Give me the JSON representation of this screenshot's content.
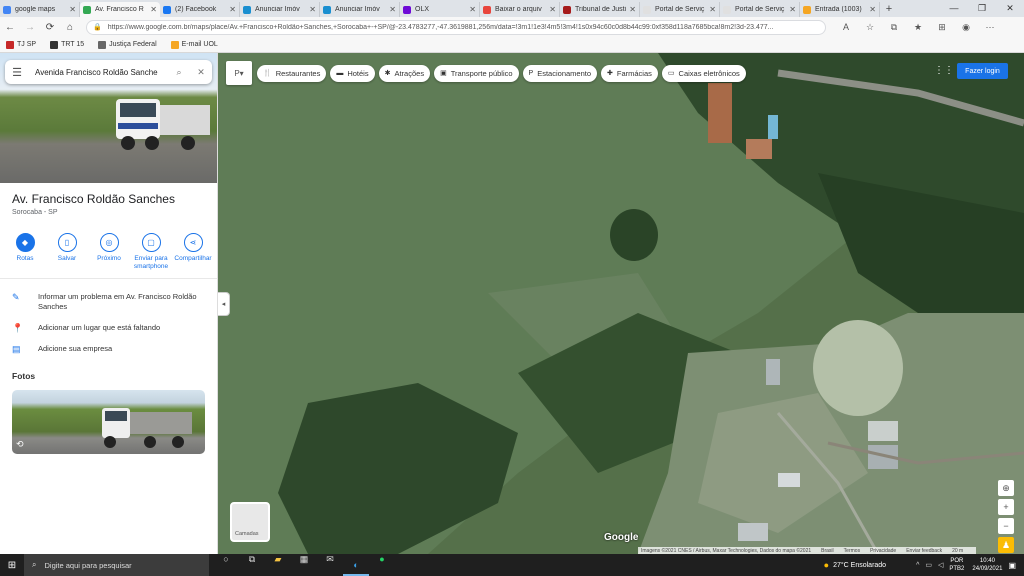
{
  "browser": {
    "tabs": [
      {
        "title": "google maps",
        "color": "#4285f4",
        "active": false
      },
      {
        "title": "Av. Francisco R",
        "color": "#34a853",
        "active": true
      },
      {
        "title": "(2) Facebook",
        "color": "#1877f2",
        "active": false
      },
      {
        "title": "Anunciar Imóv",
        "color": "#1a8fd0",
        "active": false
      },
      {
        "title": "Anunciar Imóv",
        "color": "#1a8fd0",
        "active": false
      },
      {
        "title": "OLX",
        "color": "#6e0ad6",
        "active": false
      },
      {
        "title": "Baixar o arquiv",
        "color": "#e8453c",
        "active": false
      },
      {
        "title": "Tribunal de Justi",
        "color": "#a61b1b",
        "active": false
      },
      {
        "title": "Portal de Serviç",
        "color": "#e0e0e0",
        "active": false
      },
      {
        "title": "Portal de Serviç",
        "color": "#e0e0e0",
        "active": false
      },
      {
        "title": "Entrada (1003)",
        "color": "#f5a623",
        "active": false
      }
    ],
    "new_tab": "+",
    "window_controls": [
      "—",
      "❐",
      "✕"
    ],
    "url": "https://www.google.com.br/maps/place/Av.+Francisco+Roldão+Sanches,+Sorocaba+-+SP/@-23.4783277,-47.3619881,256m/data=!3m1!1e3!4m5!3m4!1s0x94c60c0d8b44c99:0xf358d118a7685bca!8m2!3d-23.477...",
    "bookmarks": [
      {
        "label": "TJ SP",
        "color": "#c62828"
      },
      {
        "label": "TRT 15",
        "color": "#333333"
      },
      {
        "label": "Justiça Federal",
        "color": "#666666"
      },
      {
        "label": "E-mail UOL",
        "color": "#f5a623"
      }
    ]
  },
  "panel": {
    "search_value": "Avenida Francisco Roldão Sanche",
    "title": "Av. Francisco Roldão Sanches",
    "subtitle": "Sorocaba - SP",
    "actions": [
      {
        "label": "Rotas",
        "icon": "directions-icon"
      },
      {
        "label": "Salvar",
        "icon": "bookmark-icon"
      },
      {
        "label": "Próximo",
        "icon": "nearby-icon"
      },
      {
        "label": "Enviar para smartphone",
        "icon": "phone-icon"
      },
      {
        "label": "Compartilhar",
        "icon": "share-icon"
      }
    ],
    "info": [
      {
        "text": "Informar um problema em Av. Francisco Roldão Sanches",
        "icon": "pencil-icon"
      },
      {
        "text": "Adicionar um lugar que está faltando",
        "icon": "add-place-icon"
      },
      {
        "text": "Adicione sua empresa",
        "icon": "business-icon"
      }
    ],
    "photos_heading": "Fotos"
  },
  "map": {
    "chips": [
      {
        "label": "Restaurantes",
        "icon": "restaurant-icon"
      },
      {
        "label": "Hotéis",
        "icon": "hotel-icon"
      },
      {
        "label": "Atrações",
        "icon": "attractions-icon"
      },
      {
        "label": "Transporte público",
        "icon": "transit-icon"
      },
      {
        "label": "Estacionamento",
        "icon": "parking-icon"
      },
      {
        "label": "Farmácias",
        "icon": "pharmacy-icon"
      },
      {
        "label": "Caixas eletrônicos",
        "icon": "atm-icon"
      }
    ],
    "login": "Fazer login",
    "layer_label": "Camadas",
    "logo": "Google",
    "attribution": [
      "Imagens ©2021 CNES / Airbus, Maxar Technologies, Dados do mapa ©2021",
      "Brasil",
      "Termos",
      "Privacidade",
      "Enviar feedback",
      "20 m"
    ]
  },
  "taskbar": {
    "search_placeholder": "Digite aqui para pesquisar",
    "weather": "27°C  Ensolarado",
    "lang_top": "POR",
    "lang_bottom": "PTB2",
    "time": "10:40",
    "date": "24/09/2021"
  }
}
